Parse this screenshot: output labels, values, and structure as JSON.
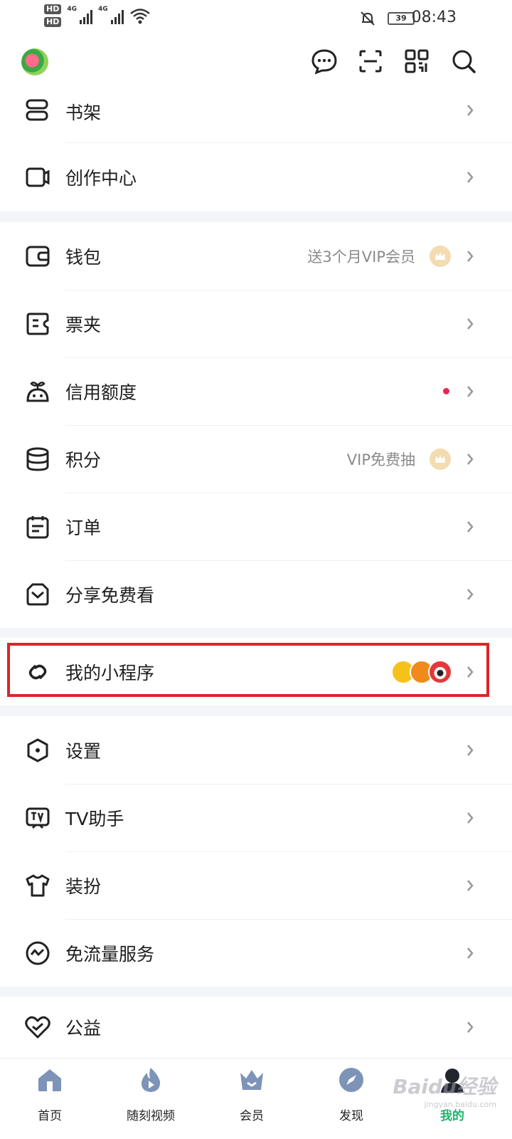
{
  "status_bar": {
    "sim1": "HD",
    "sim2": "HD",
    "net1": "4G",
    "net2": "4G",
    "battery": "39",
    "time": "08:43"
  },
  "header": {
    "icons": [
      "message-icon",
      "scan-icon",
      "qrcode-icon",
      "search-icon"
    ]
  },
  "menu": {
    "group1": [
      {
        "label": "书架",
        "icon": "bookshelf-icon"
      },
      {
        "label": "创作中心",
        "icon": "creation-center-icon"
      }
    ],
    "group2": [
      {
        "label": "钱包",
        "icon": "wallet-icon",
        "extra": "送3个月VIP会员"
      },
      {
        "label": "票夹",
        "icon": "ticket-icon"
      },
      {
        "label": "信用额度",
        "icon": "credit-icon"
      },
      {
        "label": "积分",
        "icon": "points-icon",
        "extra": "VIP免费抽"
      },
      {
        "label": "订单",
        "icon": "order-icon"
      },
      {
        "label": "分享免费看",
        "icon": "share-icon"
      }
    ],
    "group3": [
      {
        "label": "我的小程序",
        "icon": "mini-program-icon"
      }
    ],
    "group4": [
      {
        "label": "设置",
        "icon": "settings-icon"
      },
      {
        "label": "TV助手",
        "icon": "tv-icon"
      },
      {
        "label": "装扮",
        "icon": "dressup-icon"
      },
      {
        "label": "免流量服务",
        "icon": "free-data-icon"
      }
    ],
    "group5": [
      {
        "label": "公益",
        "icon": "charity-icon"
      }
    ]
  },
  "tabbar": {
    "tabs": [
      {
        "label": "首页",
        "icon": "home-icon"
      },
      {
        "label": "随刻视频",
        "icon": "flame-icon"
      },
      {
        "label": "会员",
        "icon": "vip-crown-icon"
      },
      {
        "label": "发现",
        "icon": "compass-icon"
      },
      {
        "label": "我的",
        "icon": "profile-icon",
        "active": true
      }
    ]
  },
  "colors": {
    "accent": "#1bb56e",
    "highlight_border": "#e0232b",
    "red_dot": "#e5284e",
    "vip_gold": "#f2dcb0"
  },
  "watermark": {
    "text": "Baidu经验",
    "sub": "jingyan.baidu.com"
  }
}
